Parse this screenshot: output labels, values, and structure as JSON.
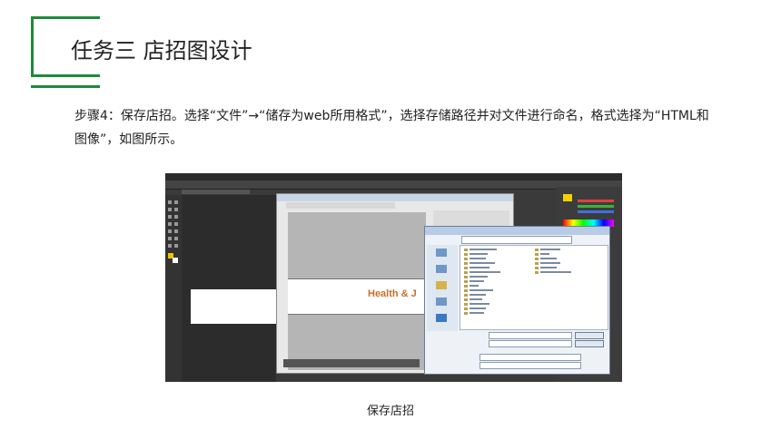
{
  "title": "任务三 店招图设计",
  "paragraph": "步骤4：保存店招。选择“文件”→“储存为web所用格式”，选择存储路径并对文件进行命名，格式选择为“HTML和图像”，如图所示。",
  "caption": "保存店招",
  "screenshot": {
    "banner_text": "Health & J",
    "accent_color": "#1f8a3a",
    "banner_color": "#c8702a"
  }
}
